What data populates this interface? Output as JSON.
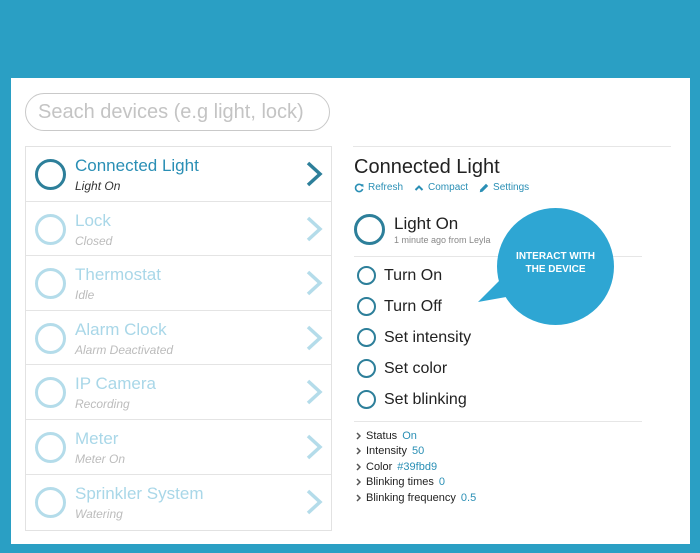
{
  "search": {
    "placeholder": "Seach devices (e.g light, lock)"
  },
  "devices": [
    {
      "name": "Connected Light",
      "status": "Light On",
      "active": true
    },
    {
      "name": "Lock",
      "status": "Closed"
    },
    {
      "name": "Thermostat",
      "status": "Idle"
    },
    {
      "name": "Alarm Clock",
      "status": "Alarm Deactivated"
    },
    {
      "name": "IP Camera",
      "status": "Recording"
    },
    {
      "name": "Meter",
      "status": "Meter On"
    },
    {
      "name": "Sprinkler System",
      "status": "Watering"
    }
  ],
  "detail": {
    "title": "Connected Light",
    "actions": {
      "refresh": "Refresh",
      "compact": "Compact",
      "settings": "Settings"
    },
    "state": {
      "label": "Light On",
      "time": "1 minute ago from Leyla"
    },
    "commands": [
      "Turn On",
      "Turn Off",
      "Set intensity",
      "Set color",
      "Set blinking"
    ],
    "properties": [
      {
        "name": "Status",
        "value": "On"
      },
      {
        "name": "Intensity",
        "value": "50"
      },
      {
        "name": "Color",
        "value": "#39fbd9"
      },
      {
        "name": "Blinking times",
        "value": "0"
      },
      {
        "name": "Blinking frequency",
        "value": "0.5"
      }
    ]
  },
  "callout": {
    "text": "INTERACT WITH THE DEVICE"
  },
  "colors": {
    "background": "#2a9fc4",
    "accent": "#2a8fb5",
    "ring_active": "#2d7f9a",
    "ring_inactive": "#b4dcea",
    "bubble": "#2ea6d3"
  },
  "icons": {
    "refresh": "refresh-icon",
    "compact": "chevron-up-icon",
    "settings": "pencil-icon",
    "device_row": "chevron-right-icon",
    "property_row": "chevron-right-icon"
  }
}
